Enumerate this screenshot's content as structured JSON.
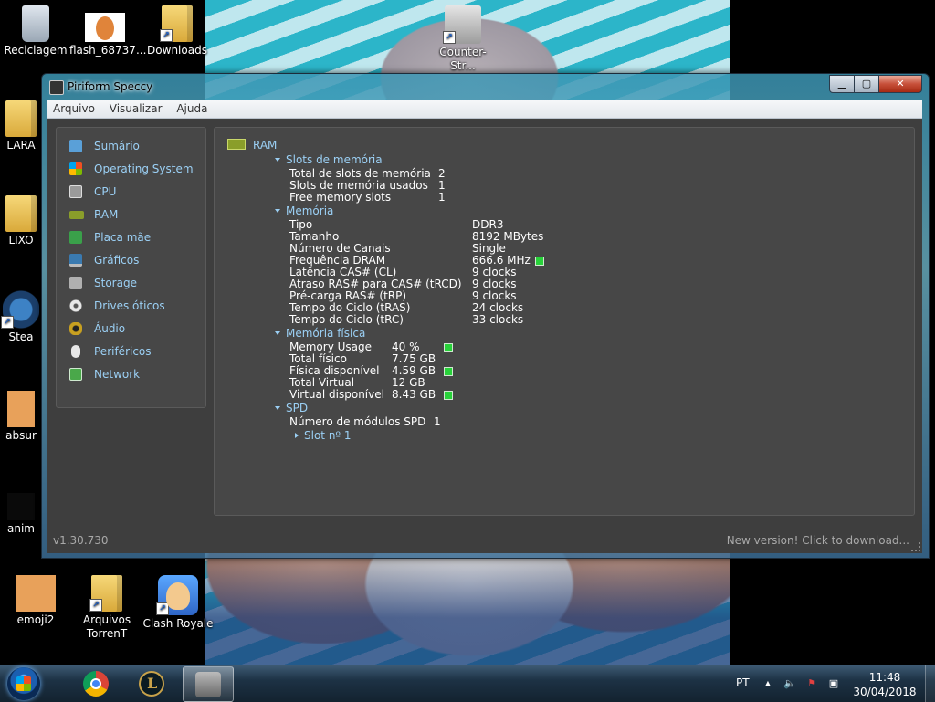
{
  "desktop": {
    "icons": [
      {
        "label": "Reciclagem"
      },
      {
        "label": "flash_68737..."
      },
      {
        "label": "Downloads"
      },
      {
        "label": "Counter-Str..."
      },
      {
        "label": "LARA"
      },
      {
        "label": "LIXO"
      },
      {
        "label": "Stea"
      },
      {
        "label": "absur"
      },
      {
        "label": "anim"
      },
      {
        "label": "emoji2"
      },
      {
        "label": "Arquivos TorrenT"
      },
      {
        "label": "Clash Royale"
      }
    ]
  },
  "window": {
    "title": "Piriform Speccy",
    "controls": {
      "minimize": "▁",
      "maximize": "▢",
      "close": "✕"
    },
    "menu": [
      "Arquivo",
      "Visualizar",
      "Ajuda"
    ],
    "sidebar": [
      {
        "label": "Sumário",
        "icon": "clipboard-icon",
        "color": "#5aa0d8"
      },
      {
        "label": "Operating System",
        "icon": "windows-logo-icon",
        "color": "#e05a2a"
      },
      {
        "label": "CPU",
        "icon": "cpu-chip-icon",
        "color": "#9a9a9a"
      },
      {
        "label": "RAM",
        "icon": "ram-module-icon",
        "color": "#8a9e2a"
      },
      {
        "label": "Placa mãe",
        "icon": "motherboard-icon",
        "color": "#3aa04a"
      },
      {
        "label": "Gráficos",
        "icon": "monitor-icon",
        "color": "#3a7ab0"
      },
      {
        "label": "Storage",
        "icon": "hard-drive-icon",
        "color": "#b0b0b0"
      },
      {
        "label": "Drives óticos",
        "icon": "optical-disc-icon",
        "color": "#d8d8d8"
      },
      {
        "label": "Áudio",
        "icon": "speaker-icon",
        "color": "#c8a020"
      },
      {
        "label": "Periféricos",
        "icon": "mouse-icon",
        "color": "#e8e8e8"
      },
      {
        "label": "Network",
        "icon": "network-icon",
        "color": "#4aa84a"
      }
    ],
    "content": {
      "heading": "RAM",
      "slots": {
        "title": "Slots de memória",
        "rows": [
          {
            "label": "Total de slots de memória",
            "value": "2"
          },
          {
            "label": "Slots de memória usados",
            "value": "1"
          },
          {
            "label": "Free memory slots",
            "value": "1"
          }
        ]
      },
      "memory": {
        "title": "Memória",
        "rows": [
          {
            "label": "Tipo",
            "value": "DDR3"
          },
          {
            "label": "Tamanho",
            "value": "8192 MBytes"
          },
          {
            "label": "Número de Canais",
            "value": "Single"
          },
          {
            "label": "Frequência DRAM",
            "value": "666.6 MHz"
          },
          {
            "label": "Latência CAS# (CL)",
            "value": "9 clocks"
          },
          {
            "label": "Atraso RAS# para CAS# (tRCD)",
            "value": "9 clocks"
          },
          {
            "label": "Pré-carga RAS# (tRP)",
            "value": "9 clocks"
          },
          {
            "label": "Tempo do Ciclo (tRAS)",
            "value": "24 clocks"
          },
          {
            "label": "Tempo do Ciclo (tRC)",
            "value": "33 clocks"
          }
        ]
      },
      "physical": {
        "title": "Memória física",
        "rows": [
          {
            "label": "Memory Usage",
            "value": "40 %"
          },
          {
            "label": "Total físico",
            "value": "7.75 GB"
          },
          {
            "label": "Física disponível",
            "value": "4.59 GB"
          },
          {
            "label": "Total Virtual",
            "value": "12 GB"
          },
          {
            "label": "Virtual disponível",
            "value": "8.43 GB"
          }
        ]
      },
      "spd": {
        "title": "SPD",
        "modules_label": "Número de módulos SPD",
        "modules_value": "1",
        "slot_label": "Slot nº 1"
      },
      "indicator_color": "#28d23a"
    },
    "status": {
      "version": "v1.30.730",
      "update": "New version! Click to download..."
    }
  },
  "taskbar": {
    "apps": [
      {
        "name": "chrome-icon"
      },
      {
        "name": "league-of-legends-icon"
      },
      {
        "name": "speccy-icon"
      }
    ],
    "language": "PT",
    "tray": {
      "show_hidden": "▲",
      "volume": "🔈",
      "flag": "⚑",
      "network": "▣"
    },
    "time": "11:48",
    "date": "30/04/2018"
  }
}
